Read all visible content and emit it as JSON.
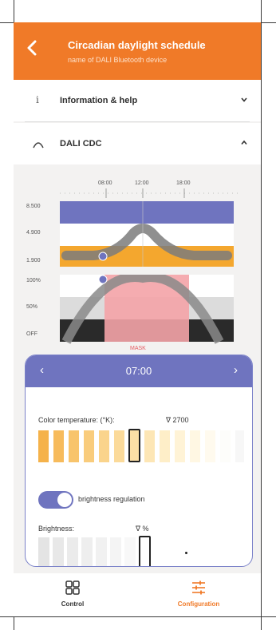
{
  "header": {
    "title": "Circadian daylight schedule",
    "subtitle": "name of DALI Bluetooth device"
  },
  "sections": [
    {
      "icon": "i",
      "label": "Information & help",
      "expanded": false
    },
    {
      "icon": "dali-arc",
      "label": "DALI CDC",
      "expanded": true
    }
  ],
  "chart": {
    "x_ticks": [
      "08:00",
      "12:00",
      "18:00"
    ],
    "upper": {
      "y_ticks": [
        "8.500",
        "4.900",
        "1.900"
      ]
    },
    "lower": {
      "y_ticks": [
        "100%",
        "50%",
        "OFF"
      ]
    },
    "mask_label": "MASK"
  },
  "schedule": {
    "time": "07:00",
    "prev": "‹",
    "next": "›",
    "color_temp_label": "Color temperature: (°K):",
    "color_temp_value": "∇  2700",
    "brightness_toggle_label": "brightness regulation",
    "brightness_toggle_on": true,
    "brightness_label": "Brightness:",
    "brightness_value": "∇  %"
  },
  "bottom_nav": {
    "items": [
      {
        "label": "Control",
        "icon": "grid-icon",
        "active": false
      },
      {
        "label": "Configuration",
        "icon": "sliders-icon",
        "active": true
      }
    ]
  },
  "colors": {
    "accent_orange": "#f07a28",
    "accent_purple": "#6f74bf",
    "mask_pink": "#f4a3a7"
  }
}
